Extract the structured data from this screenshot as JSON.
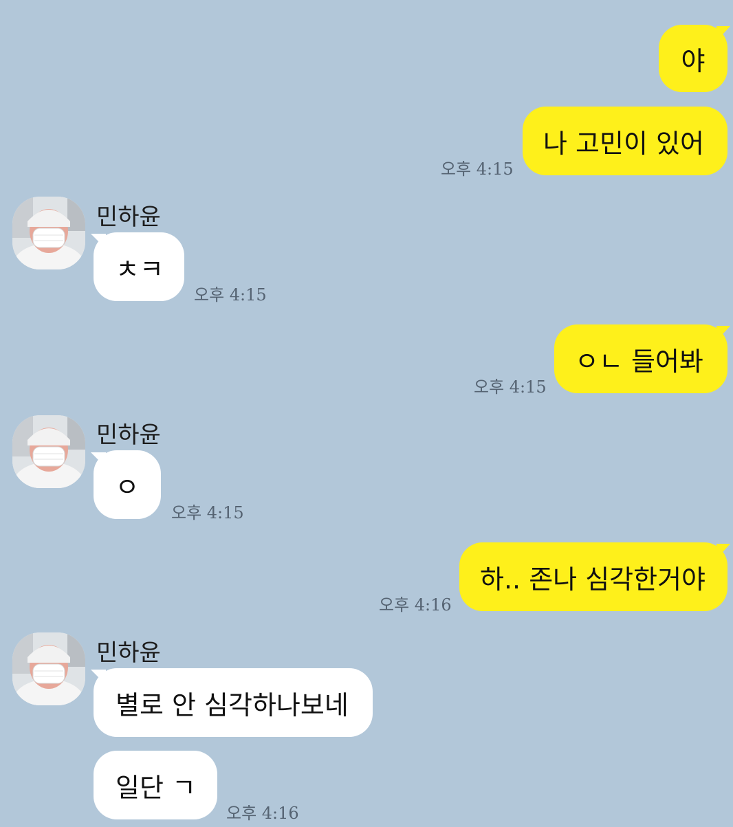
{
  "contact": {
    "name": "민하윤"
  },
  "colors": {
    "background": "#b2c7d9",
    "my_bubble": "#fef01b",
    "their_bubble": "#ffffff",
    "timestamp": "#556372"
  },
  "messages": [
    {
      "sender": "me",
      "text": "야"
    },
    {
      "sender": "me",
      "text": "나 고민이 있어",
      "time": "오후 4:15"
    },
    {
      "sender": "them",
      "text": "ㅊㅋ",
      "time": "오후 4:15"
    },
    {
      "sender": "me",
      "text": "ㅇㄴ 들어봐",
      "time": "오후 4:15"
    },
    {
      "sender": "them",
      "text": "ㅇ",
      "time": "오후 4:15"
    },
    {
      "sender": "me",
      "text": "하.. 존나 심각한거야",
      "time": "오후 4:16"
    },
    {
      "sender": "them",
      "text": "별로 안 심각하나보네"
    },
    {
      "sender": "them",
      "text": "일단 ㄱ",
      "time": "오후 4:16"
    }
  ]
}
